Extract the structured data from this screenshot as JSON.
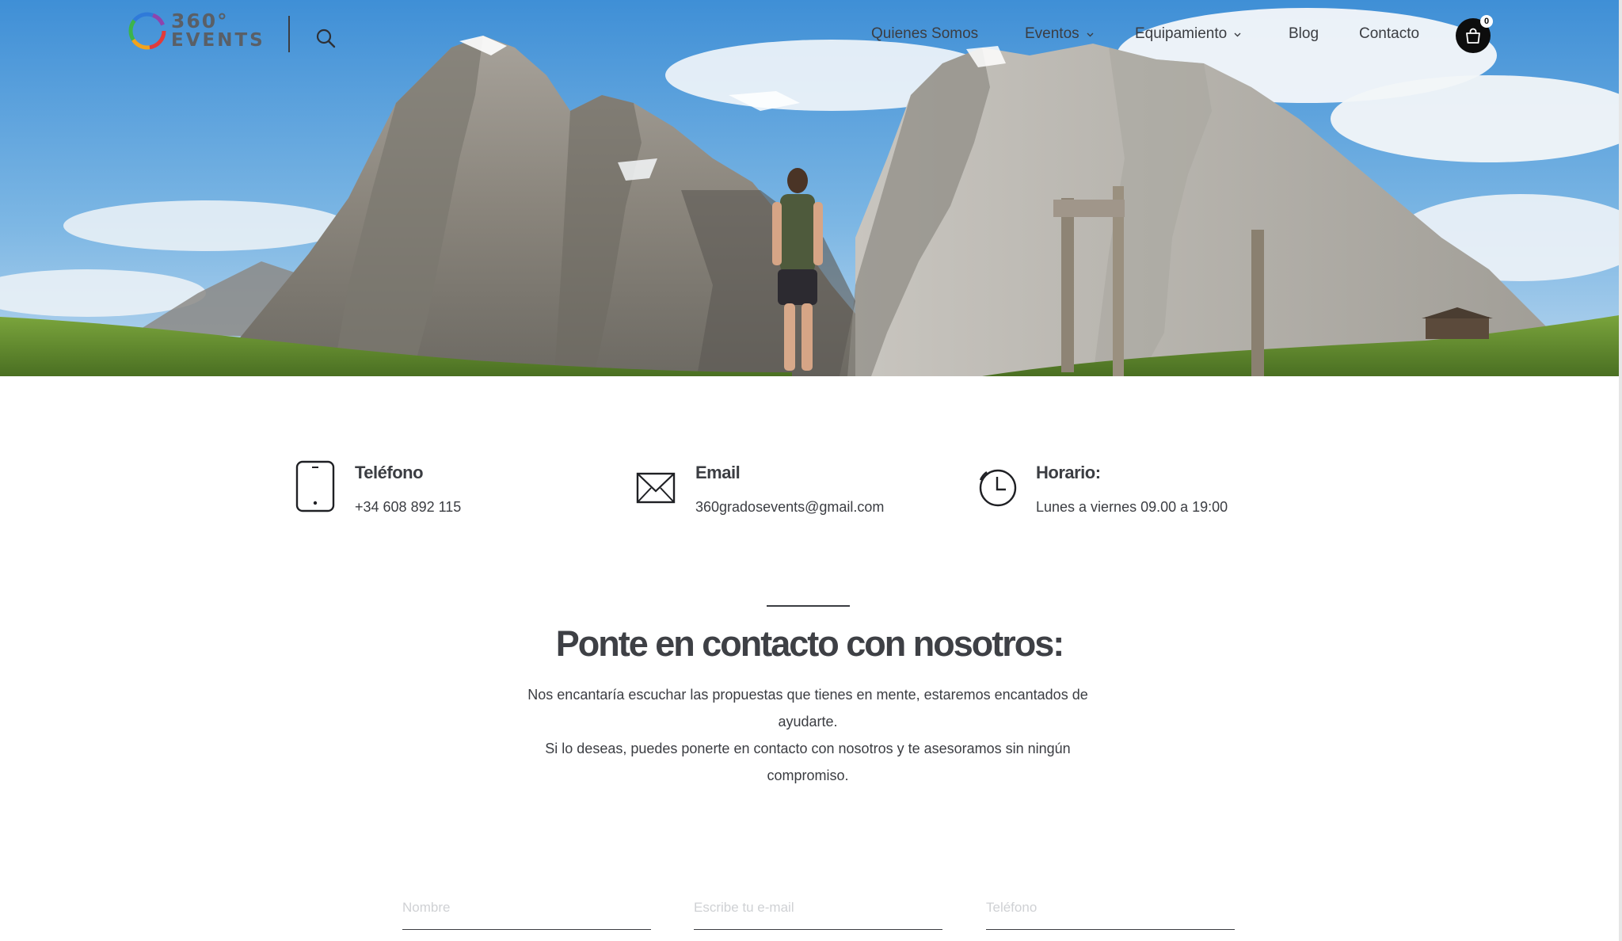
{
  "brand": {
    "logo_line1": "360°",
    "logo_line2": "EVENTS"
  },
  "nav": {
    "items": [
      {
        "label": "Quienes Somos",
        "has_dropdown": false
      },
      {
        "label": "Eventos",
        "has_dropdown": true
      },
      {
        "label": "Equipamiento",
        "has_dropdown": true
      },
      {
        "label": "Blog",
        "has_dropdown": false
      },
      {
        "label": "Contacto",
        "has_dropdown": false
      }
    ],
    "cart_count": "0"
  },
  "contact_info": [
    {
      "icon": "phone-icon",
      "title": "Teléfono",
      "value": "+34 608 892 115"
    },
    {
      "icon": "mail-icon",
      "title": "Email",
      "value": "360gradosevents@gmail.com"
    },
    {
      "icon": "clock-icon",
      "title": "Horario:",
      "value": "Lunes a viernes 09.00 a 19:00"
    }
  ],
  "contact_section": {
    "title": "Ponte en contacto con nosotros:",
    "text_line1": "Nos encantaría escuchar las propuestas que tienes en mente, estaremos encantados de ayudarte.",
    "text_line2": "Si lo deseas, puedes ponerte en contacto con nosotros y te asesoramos sin ningún compromiso."
  },
  "form": {
    "name_placeholder": "Nombre",
    "email_placeholder": "Escribe tu e-mail",
    "phone_placeholder": "Teléfono"
  },
  "colors": {
    "text": "#3b3d42",
    "cart_bg": "#0d0d0d",
    "sky": "#5fa3da",
    "grass": "#5f8a2e"
  }
}
